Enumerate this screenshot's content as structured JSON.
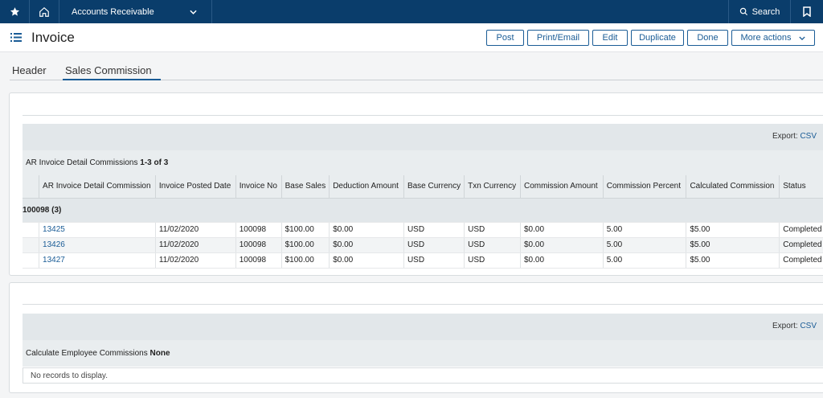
{
  "topbar": {
    "module": "Accounts Receivable",
    "search_label": "Search"
  },
  "page": {
    "title": "Invoice"
  },
  "actions": {
    "post": "Post",
    "print_email": "Print/Email",
    "edit": "Edit",
    "duplicate": "Duplicate",
    "done": "Done",
    "more": "More actions"
  },
  "tabs": [
    {
      "label": "Header"
    },
    {
      "label": "Sales Commission"
    }
  ],
  "commissions": {
    "export_label": "Export:",
    "export_csv": "CSV",
    "caption_title": "AR Invoice Detail Commissions",
    "caption_count": "1-3 of 3",
    "columns": [
      "AR Invoice Detail Commission",
      "Invoice Posted Date",
      "Invoice No",
      "Base Sales",
      "Deduction Amount",
      "Base Currency",
      "Txn Currency",
      "Commission Amount",
      "Commission Percent",
      "Calculated Commission",
      "Status"
    ],
    "group_label": "100098 (3)",
    "rows": [
      [
        "13425",
        "11/02/2020",
        "100098",
        "$100.00",
        "$0.00",
        "USD",
        "USD",
        "$0.00",
        "5.00",
        "$5.00",
        "Completed"
      ],
      [
        "13426",
        "11/02/2020",
        "100098",
        "$100.00",
        "$0.00",
        "USD",
        "USD",
        "$0.00",
        "5.00",
        "$5.00",
        "Completed"
      ],
      [
        "13427",
        "11/02/2020",
        "100098",
        "$100.00",
        "$0.00",
        "USD",
        "USD",
        "$0.00",
        "5.00",
        "$5.00",
        "Completed"
      ]
    ]
  },
  "employee": {
    "export_label": "Export:",
    "export_csv": "CSV",
    "caption_title": "Calculate Employee Commissions",
    "caption_count": "None",
    "empty_text": "No records to display."
  },
  "colors": {
    "topbar": "#0a3d6b",
    "accent": "#1a5c96"
  }
}
